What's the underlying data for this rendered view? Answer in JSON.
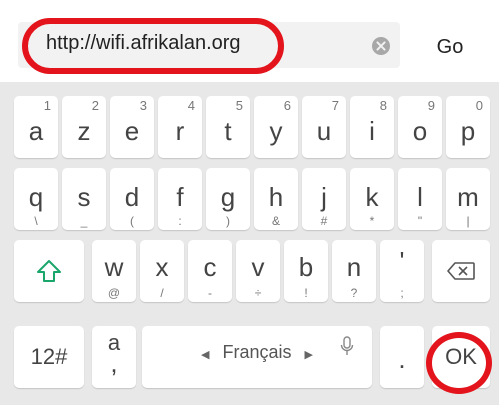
{
  "address_bar": {
    "url": "http://wifi.afrikalan.org",
    "go_label": "Go"
  },
  "keyboard": {
    "row1": [
      {
        "char": "a",
        "num": "1"
      },
      {
        "char": "z",
        "num": "2"
      },
      {
        "char": "e",
        "num": "3"
      },
      {
        "char": "r",
        "num": "4"
      },
      {
        "char": "t",
        "num": "5"
      },
      {
        "char": "y",
        "num": "6"
      },
      {
        "char": "u",
        "num": "7"
      },
      {
        "char": "i",
        "num": "8"
      },
      {
        "char": "o",
        "num": "9"
      },
      {
        "char": "p",
        "num": "0"
      }
    ],
    "row2": [
      {
        "char": "q",
        "sub": "\\"
      },
      {
        "char": "s",
        "sub": "_"
      },
      {
        "char": "d",
        "sub": "("
      },
      {
        "char": "f",
        "sub": ":"
      },
      {
        "char": "g",
        "sub": ")"
      },
      {
        "char": "h",
        "sub": "&"
      },
      {
        "char": "j",
        "sub": "#"
      },
      {
        "char": "k",
        "sub": "*"
      },
      {
        "char": "l",
        "sub": "\""
      },
      {
        "char": "m",
        "sub": "|"
      }
    ],
    "row3": [
      {
        "char": "w",
        "sub": "@"
      },
      {
        "char": "x",
        "sub": "/"
      },
      {
        "char": "c",
        "sub": "-"
      },
      {
        "char": "v",
        "sub": "÷"
      },
      {
        "char": "b",
        "sub": "!"
      },
      {
        "char": "n",
        "sub": "?"
      },
      {
        "char": "'",
        "sub": ";"
      }
    ],
    "sym_label": "12#",
    "comma_key": {
      "top": "a",
      "bottom": ","
    },
    "space_label": "Français",
    "period_label": ".",
    "ok_label": "OK"
  },
  "icons": {
    "shift": "shift-arrow-icon",
    "backspace": "backspace-icon",
    "mic": "microphone-icon",
    "clear": "clear-circle-icon"
  },
  "colors": {
    "annotation": "#e3141b",
    "keyboard_bg": "#e8e8e8",
    "shift_accent": "#1aa56a"
  }
}
